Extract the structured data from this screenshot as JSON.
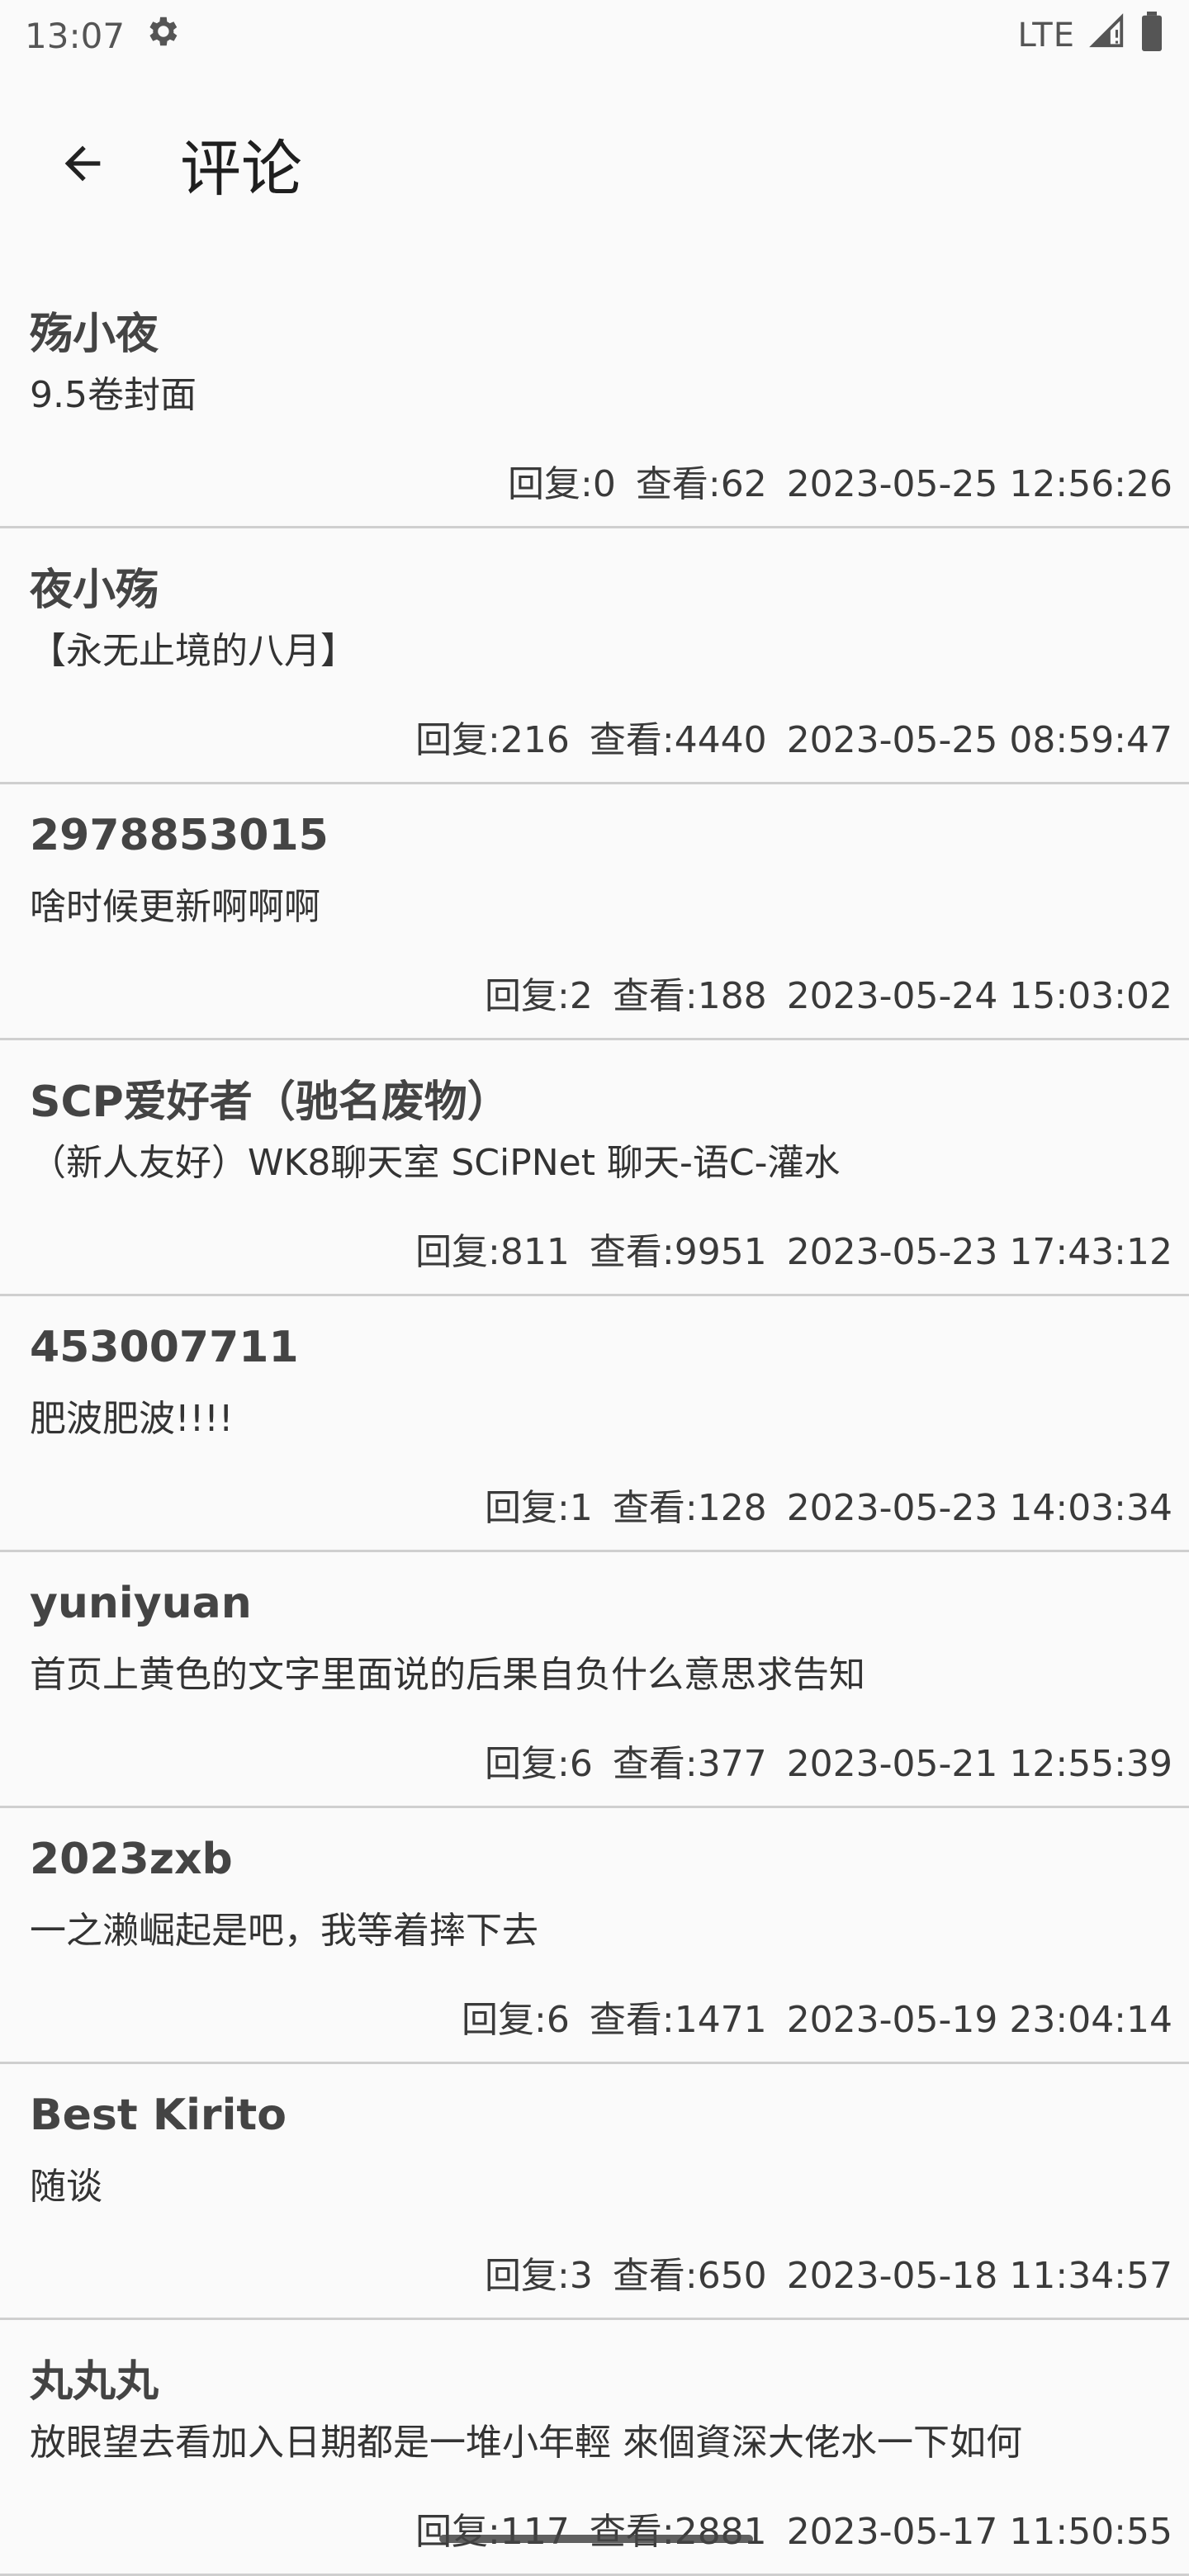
{
  "status_bar": {
    "time": "13:07",
    "network": "LTE"
  },
  "app_bar": {
    "title": "评论"
  },
  "comments": [
    {
      "author": "殇小夜",
      "subject": "9.5卷封面",
      "replies": "回复:0",
      "views": "查看:62",
      "datetime": "2023-05-25 12:56:26"
    },
    {
      "author": "夜小殇",
      "subject": "【永无止境的八月】",
      "replies": "回复:216",
      "views": "查看:4440",
      "datetime": "2023-05-25 08:59:47"
    },
    {
      "author": "2978853015",
      "subject": "啥时候更新啊啊啊",
      "replies": "回复:2",
      "views": "查看:188",
      "datetime": "2023-05-24 15:03:02"
    },
    {
      "author": "SCP爱好者（驰名废物）",
      "subject": "（新人友好）WK8聊天室 SCiPNet 聊天-语C-灌水",
      "replies": "回复:811",
      "views": "查看:9951",
      "datetime": "2023-05-23 17:43:12"
    },
    {
      "author": "453007711",
      "subject": "肥波肥波!!!!",
      "replies": "回复:1",
      "views": "查看:128",
      "datetime": "2023-05-23 14:03:34"
    },
    {
      "author": "yuniyuan",
      "subject": "首页上黄色的文字里面说的后果自负什么意思求告知",
      "replies": "回复:6",
      "views": "查看:377",
      "datetime": "2023-05-21 12:55:39"
    },
    {
      "author": "2023zxb",
      "subject": "一之濑崛起是吧，我等着摔下去",
      "replies": "回复:6",
      "views": "查看:1471",
      "datetime": "2023-05-19 23:04:14"
    },
    {
      "author": "Best Kirito",
      "subject": "随谈",
      "replies": "回复:3",
      "views": "查看:650",
      "datetime": "2023-05-18 11:34:57"
    },
    {
      "author": "丸丸丸",
      "subject": "放眼望去看加入日期都是一堆小年輕 來個資深大佬水一下如何",
      "replies": "回复:117",
      "views": "查看:2881",
      "datetime": "2023-05-17 11:50:55"
    }
  ]
}
